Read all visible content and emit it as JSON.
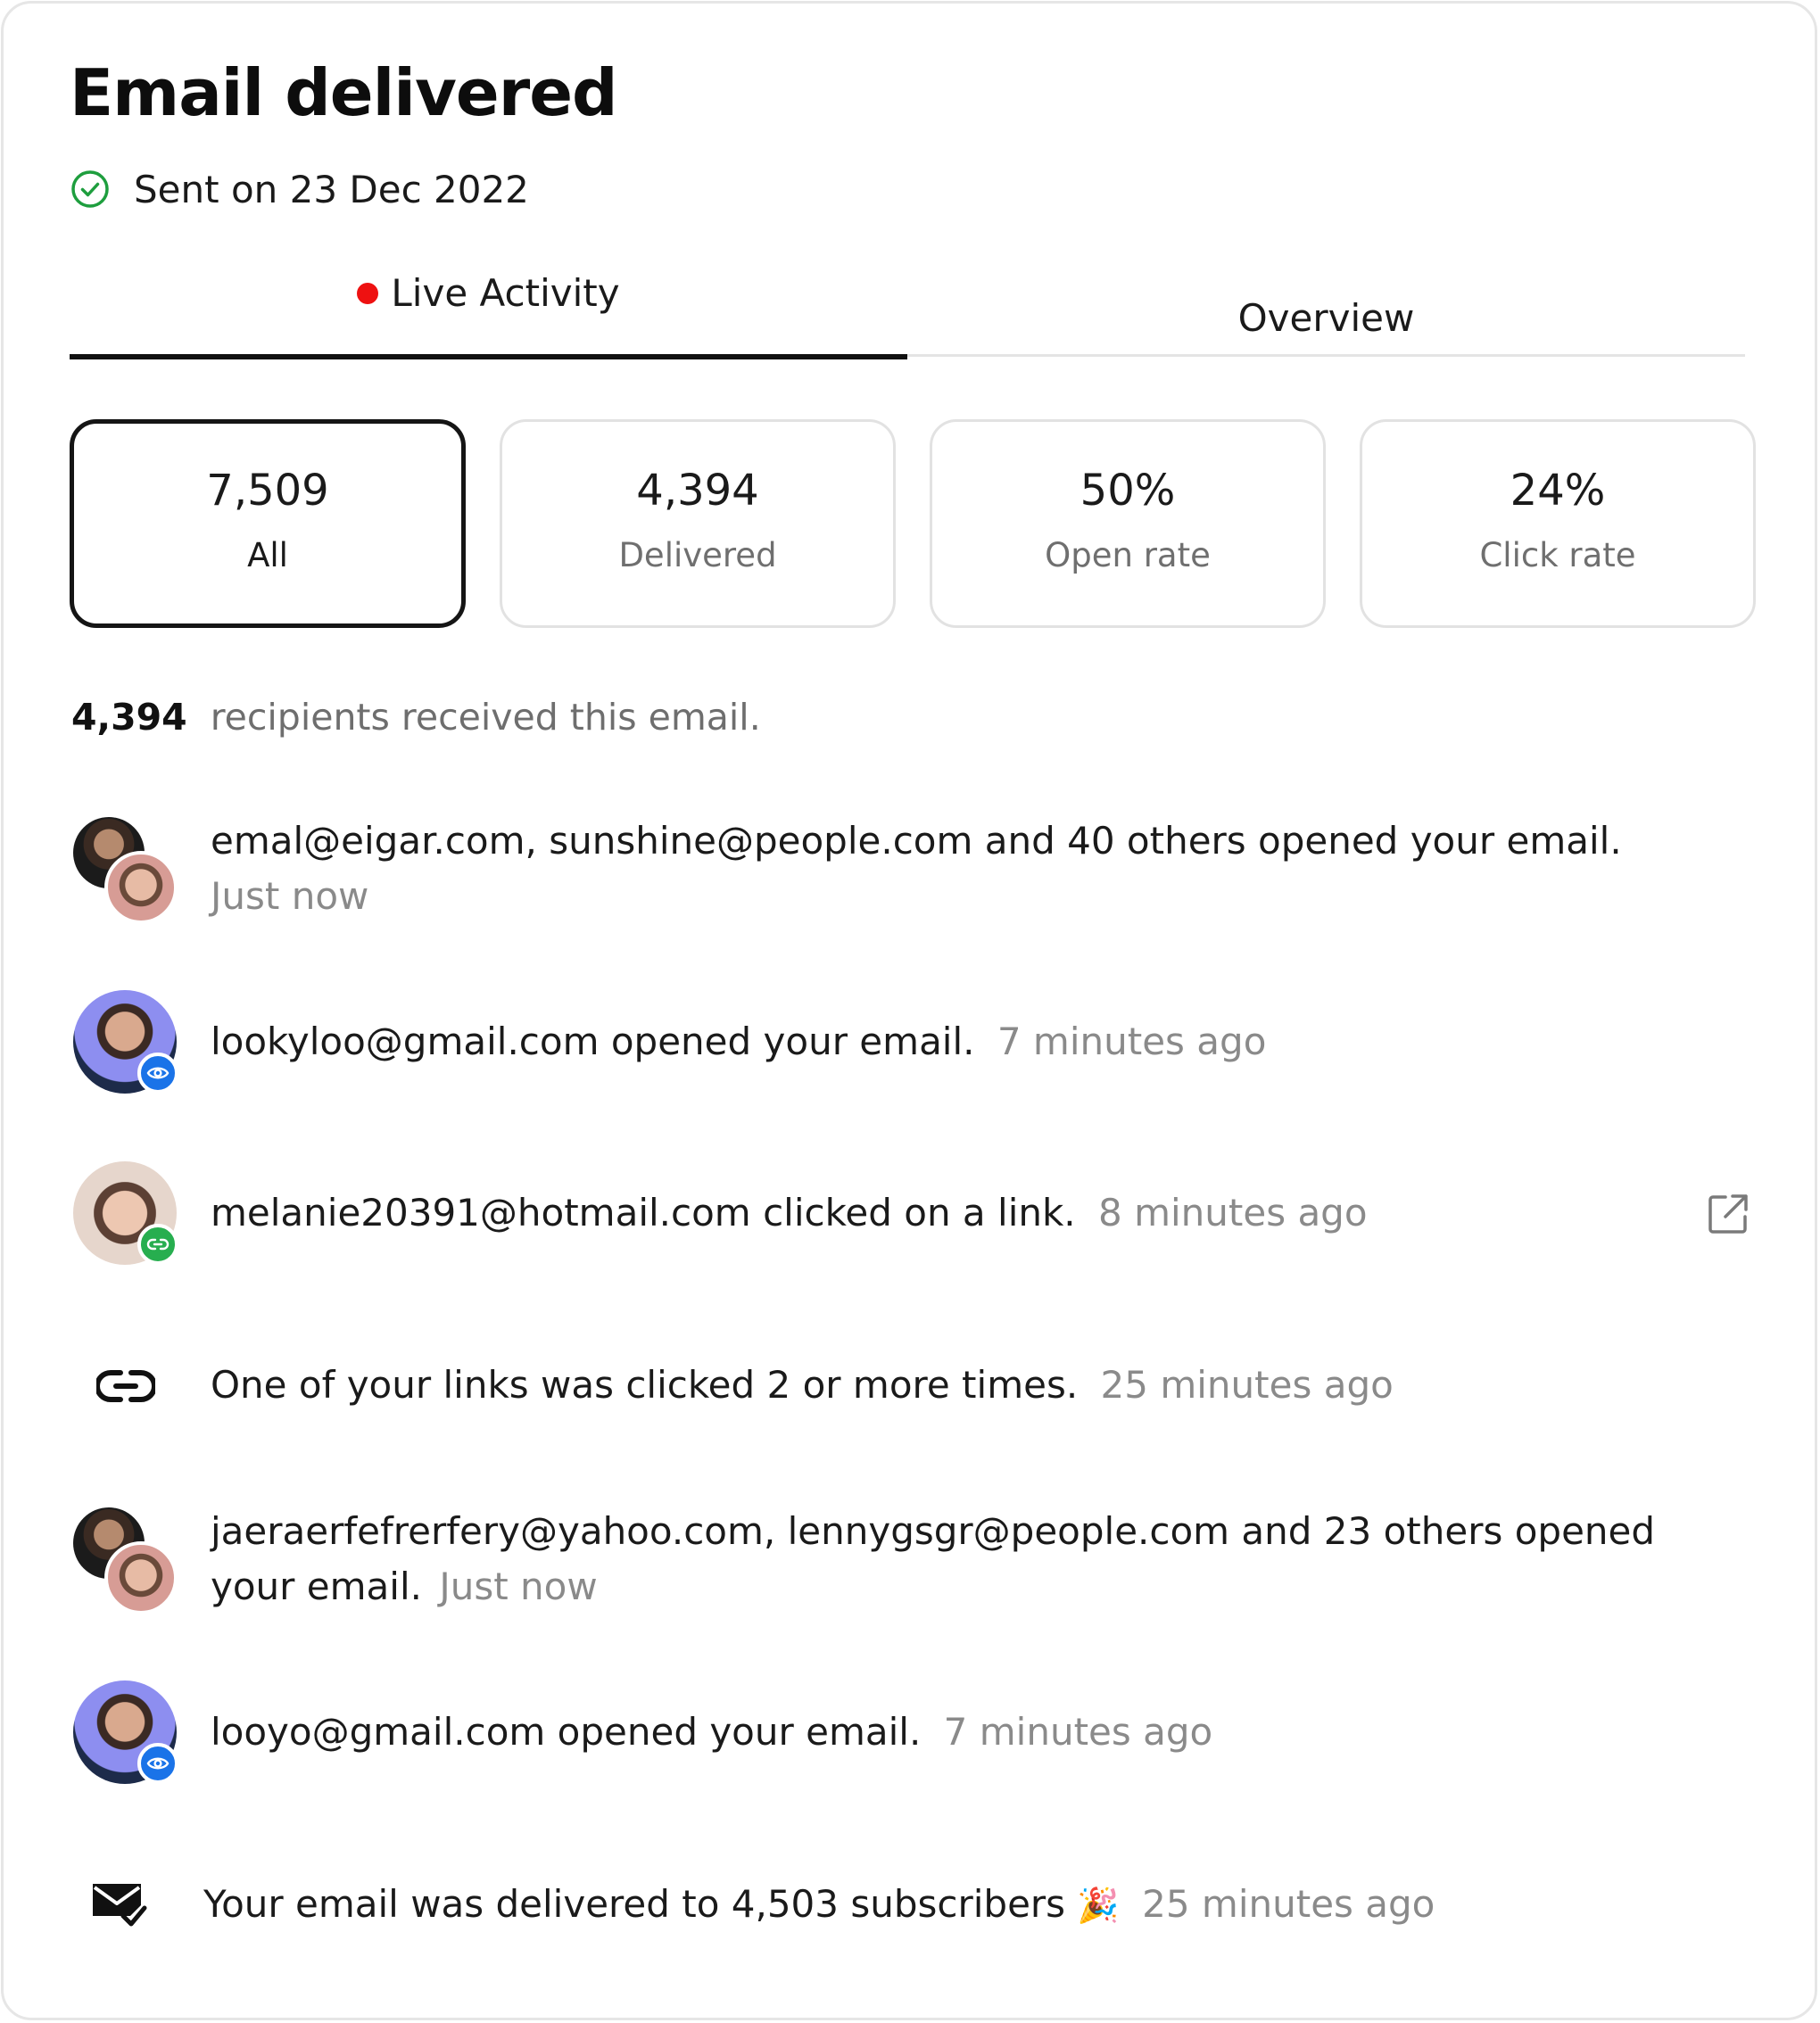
{
  "header": {
    "title": "Email delivered",
    "sent_label": "Sent on 23 Dec 2022"
  },
  "tabs": [
    {
      "label": "Live Activity",
      "active": true,
      "live_dot_color": "#ee1111"
    },
    {
      "label": "Overview",
      "active": false
    }
  ],
  "stats": [
    {
      "value": "7,509",
      "label": "All",
      "selected": true
    },
    {
      "value": "4,394",
      "label": "Delivered",
      "selected": false
    },
    {
      "value": "50%",
      "label": "Open rate",
      "selected": false
    },
    {
      "value": "24%",
      "label": "Click rate",
      "selected": false
    }
  ],
  "summary": {
    "count": "4,394",
    "text": "recipients received this email."
  },
  "activity": [
    {
      "icon": "group-avatar",
      "text": "emal@eigar.com, sunshine@people.com and 40 others opened your email.",
      "time": "Just now"
    },
    {
      "icon": "avatar-with-eye-badge",
      "text": "lookyloo@gmail.com opened your email.",
      "time": "7 minutes ago"
    },
    {
      "icon": "avatar-with-link-badge",
      "text": "melanie20391@hotmail.com clicked on a link.",
      "time": "8 minutes ago",
      "action_icon": "external-link-icon"
    },
    {
      "icon": "link-icon",
      "text": "One of your links was clicked 2 or more times.",
      "time": "25 minutes ago"
    },
    {
      "icon": "group-avatar",
      "text_line1": "jaeraerfefrerfery@yahoo.com, lennygsgr@people.com and 23 others opened",
      "text_line2": "your email.",
      "time": "Just now"
    },
    {
      "icon": "avatar-with-eye-badge",
      "text": "looyo@gmail.com opened your email.",
      "time": "7 minutes ago"
    },
    {
      "icon": "mail-check-icon",
      "text": "Your email was delivered to 4,503 subscribers",
      "emoji": "🎉",
      "time": "25 minutes ago"
    }
  ],
  "colors": {
    "success_green": "#1e9e3e",
    "live_red": "#ee1111",
    "badge_blue": "#1a73e8",
    "badge_green": "#27ae4f",
    "muted_text": "#8a8a8a"
  }
}
